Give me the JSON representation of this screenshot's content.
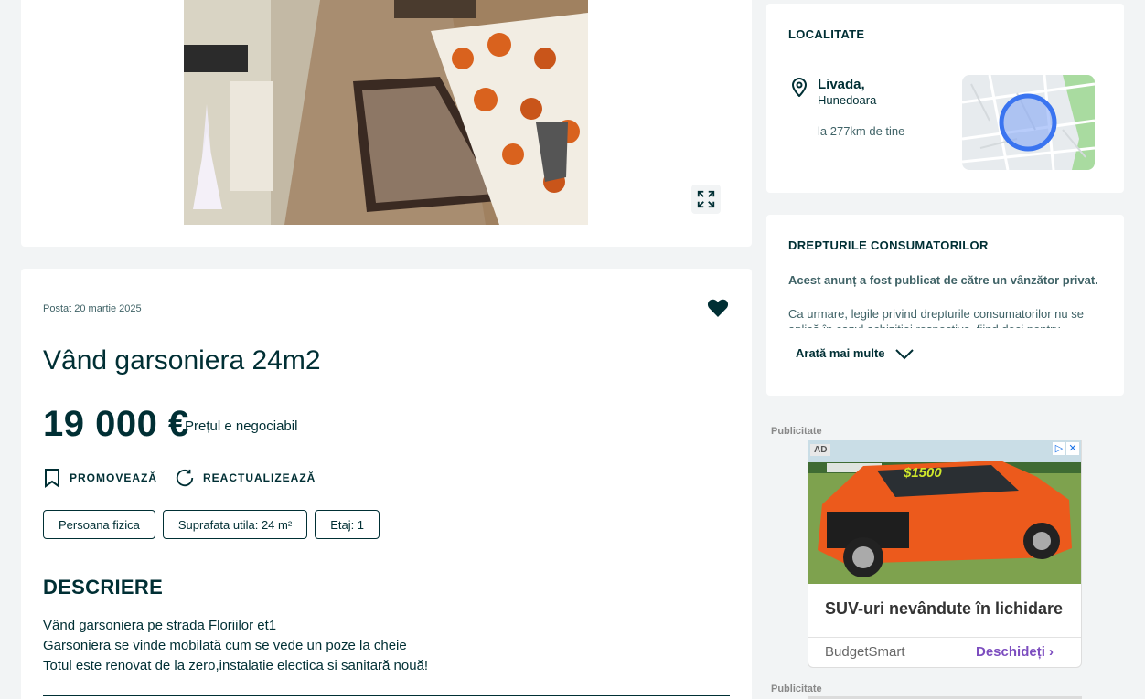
{
  "ad": {
    "posted": "Postat 20 martie 2025",
    "title": "Vând garsoniera 24m2",
    "price": "19 000 €",
    "price_note": "Prețul e negociabil",
    "promote_label": "PROMOVEAZĂ",
    "refresh_label": "REACTUALIZEAZĂ",
    "tags": [
      "Persoana fizica",
      "Suprafata utila: 24 m²",
      "Etaj: 1"
    ],
    "description_heading": "DESCRIERE",
    "description_lines": [
      "Vând garsoniera pe strada Floriilor et1",
      "Garsoniera se vinde mobilată cum se vede un poze la cheie",
      "Totul este renovat de la zero,instalatie electica si sanitară nouă!"
    ],
    "favorite_icon": "heart-icon",
    "expand_icon": "expand-icon"
  },
  "location": {
    "heading": "LOCALITATE",
    "city": "Livada,",
    "region": "Hunedoara",
    "distance": "la 277km de tine",
    "pin_icon": "location-pin-icon"
  },
  "consumer": {
    "heading": "DREPTURILE CONSUMATORILOR",
    "bold_text": "Acest anunț a fost publicat de către un vânzător privat.",
    "text": "Ca urmare, legile privind drepturile consumatorilor nu se aplică în cazul achiziției respective, fiind deci pentru",
    "more_label": "Arată mai multe"
  },
  "advert": {
    "label_1": "Publicitate",
    "label_2": "Publicitate",
    "ad_badge": "AD",
    "headline": "SUV-uri nevândute în lichidare",
    "brand": "BudgetSmart",
    "cta": "Deschideți",
    "plate_text": "$1500"
  },
  "colors": {
    "primary": "#002f34",
    "map_circle": "#3a74f0",
    "cta": "#7c4dbf"
  }
}
